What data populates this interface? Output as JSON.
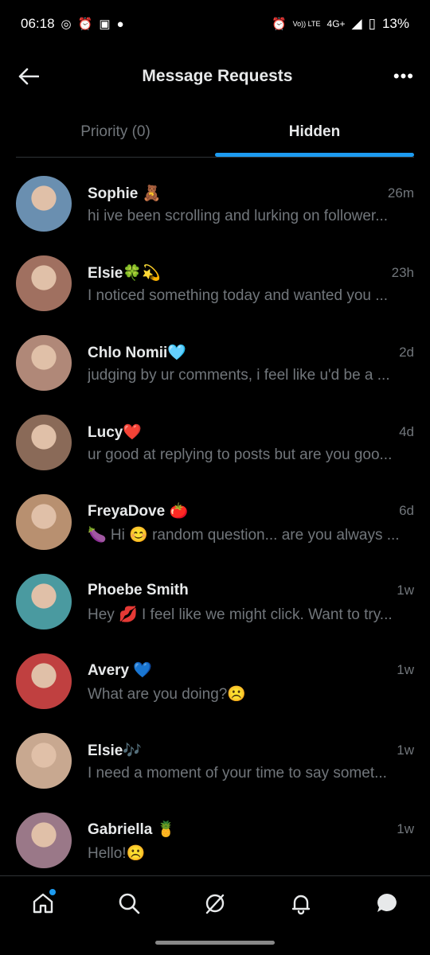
{
  "status_bar": {
    "time": "06:18",
    "network": "4G+",
    "volte": "Vo)) LTE",
    "battery": "13%"
  },
  "header": {
    "title": "Message Requests"
  },
  "tabs": [
    {
      "label": "Priority (0)",
      "active": false
    },
    {
      "label": "Hidden",
      "active": true
    }
  ],
  "messages": [
    {
      "name": "Sophie 🧸",
      "time": "26m",
      "preview": "hi ive been scrolling and lurking on follower...",
      "avatar_color": "#6a8fb0"
    },
    {
      "name": "Elsie🍀💫",
      "time": "23h",
      "preview": "I noticed something today and wanted you ...",
      "avatar_color": "#a07060"
    },
    {
      "name": "Chlo Nomii🩵",
      "time": "2d",
      "preview": "judging by ur comments, i feel like u'd be a ...",
      "avatar_color": "#b08878"
    },
    {
      "name": "Lucy❤️",
      "time": "4d",
      "preview": "ur good at replying to posts but are you goo...",
      "avatar_color": "#8a6a58"
    },
    {
      "name": "FreyaDove 🍅",
      "time": "6d",
      "preview": "🍆 Hi 😊 random question... are you always ...",
      "avatar_color": "#b89070"
    },
    {
      "name": "Phoebe Smith",
      "time": "1w",
      "preview": "Hey 💋 I feel like we might click. Want to try...",
      "avatar_color": "#4a9aa0"
    },
    {
      "name": "Avery 💙",
      "time": "1w",
      "preview": "What are you doing?☹️",
      "avatar_color": "#c04040"
    },
    {
      "name": "Elsie🎶",
      "time": "1w",
      "preview": "I need a moment of your time to say somet...",
      "avatar_color": "#c8a890"
    },
    {
      "name": "Gabriella 🍍",
      "time": "1w",
      "preview": "Hello!☹️",
      "avatar_color": "#9a7888"
    }
  ],
  "colors": {
    "accent": "#1d9bf0",
    "background": "#000000",
    "secondary_text": "#71767b"
  }
}
